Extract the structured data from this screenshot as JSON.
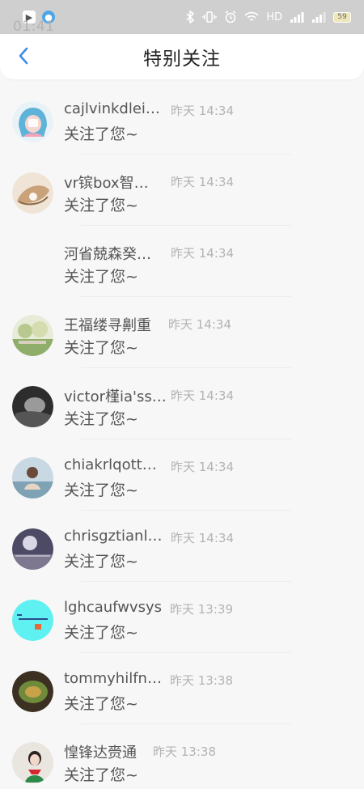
{
  "status_bar": {
    "time": "01:41",
    "icons": [
      "notification-app-icon",
      "notification-app-icon-2",
      "bluetooth-icon",
      "vibrate-icon",
      "alarm-icon",
      "wifi-icon",
      "hd-icon",
      "signal-icon",
      "signal-icon-2"
    ],
    "hd": "HD",
    "battery": "59"
  },
  "header": {
    "title": "特别关注",
    "back_icon": "chevron-left-icon",
    "accent": "#3a8ee6"
  },
  "items": [
    {
      "name": "cajlvinkdlei…",
      "time": "昨天 14:34",
      "message": "关注了您~",
      "avatar": "avatar-anime-girl"
    },
    {
      "name": "vr镔box智…",
      "time": "昨天 14:34",
      "message": "关注了您~",
      "avatar": "avatar-pearl-shell"
    },
    {
      "name": "河省兢森癸…",
      "time": "昨天 14:34",
      "message": "关注了您~",
      "avatar": "avatar-blank"
    },
    {
      "name": "王福缕寻劓重",
      "time": "昨天 14:34",
      "message": "关注了您~",
      "avatar": "avatar-garden"
    },
    {
      "name": "victor槿ia'ss…",
      "time": "昨天 14:34",
      "message": "关注了您~",
      "avatar": "avatar-bw-portrait"
    },
    {
      "name": "chiakrlqott…",
      "time": "昨天 14:34",
      "message": "关注了您~",
      "avatar": "avatar-person-coast"
    },
    {
      "name": "chrisgztianl…",
      "time": "昨天 14:34",
      "message": "关注了您~",
      "avatar": "avatar-moon-sea"
    },
    {
      "name": "lghcaufwvsys",
      "time": "昨天 13:39",
      "message": "关注了您~",
      "avatar": "avatar-cyan-text"
    },
    {
      "name": "tommyhilfn…",
      "time": "昨天 13:38",
      "message": "关注了您~",
      "avatar": "avatar-food-bowl"
    },
    {
      "name": "惶锋达赍通",
      "time": "昨天 13:38",
      "message": "关注了您~",
      "avatar": "avatar-girl-red-scarf"
    }
  ]
}
